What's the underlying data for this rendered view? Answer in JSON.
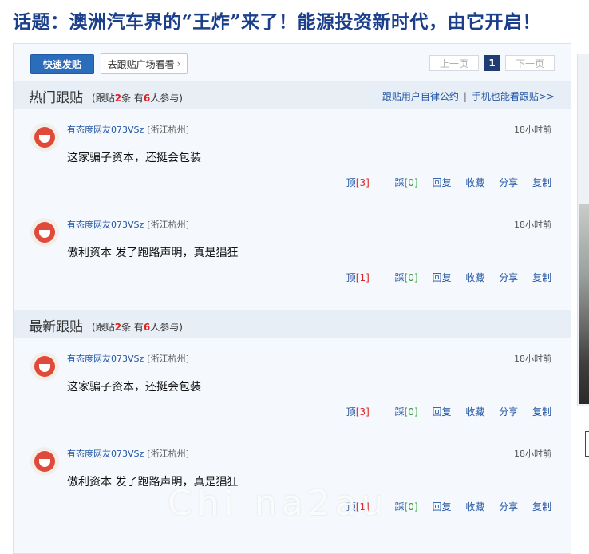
{
  "headline": "话题：澳洲汽车界的“王炸”来了！能源投资新时代，由它开启！",
  "toolbar": {
    "quick_post": "快速发贴",
    "go_plaza": "去跟贴广场看看",
    "prev": "上一页",
    "current_page": "1",
    "next": "下一页"
  },
  "hot": {
    "title": "热门跟贴",
    "meta_prefix": "跟贴",
    "post_count": "2",
    "meta_mid": "条 有",
    "people_count": "6",
    "meta_suffix": "人参与",
    "link_rules": "跟贴用户自律公约",
    "link_mobile": "手机也能看跟贴>>"
  },
  "latest": {
    "title": "最新跟贴",
    "meta_prefix": "跟贴",
    "post_count": "2",
    "meta_mid": "条 有",
    "people_count": "6",
    "meta_suffix": "人参与"
  },
  "posts": [
    {
      "user": "有态度网友073VSz",
      "location": "[浙江杭州]",
      "time": "18小时前",
      "content": "这家骗子资本，还挺会包装",
      "up_label": "顶",
      "up": "[3]",
      "down_label": "踩",
      "down": "[0]",
      "reply": "回复",
      "fav": "收藏",
      "share": "分享",
      "copy": "复制"
    },
    {
      "user": "有态度网友073VSz",
      "location": "[浙江杭州]",
      "time": "18小时前",
      "content": "傲利资本 发了跑路声明，真是猖狂",
      "up_label": "顶",
      "up": "[1]",
      "down_label": "踩",
      "down": "[0]",
      "reply": "回复",
      "fav": "收藏",
      "share": "分享",
      "copy": "复制"
    },
    {
      "user": "有态度网友073VSz",
      "location": "[浙江杭州]",
      "time": "18小时前",
      "content": "这家骗子资本，还挺会包装",
      "up_label": "顶",
      "up": "[3]",
      "down_label": "踩",
      "down": "[0]",
      "reply": "回复",
      "fav": "收藏",
      "share": "分享",
      "copy": "复制"
    },
    {
      "user": "有态度网友073VSz",
      "location": "[浙江杭州]",
      "time": "18小时前",
      "content": "傲利资本 发了跑路声明，真是猖狂",
      "up_label": "顶",
      "up": "[1]",
      "down_label": "踩",
      "down": "[0]",
      "reply": "回复",
      "fav": "收藏",
      "share": "分享",
      "copy": "复制"
    }
  ],
  "watermark": "Chi na2au"
}
